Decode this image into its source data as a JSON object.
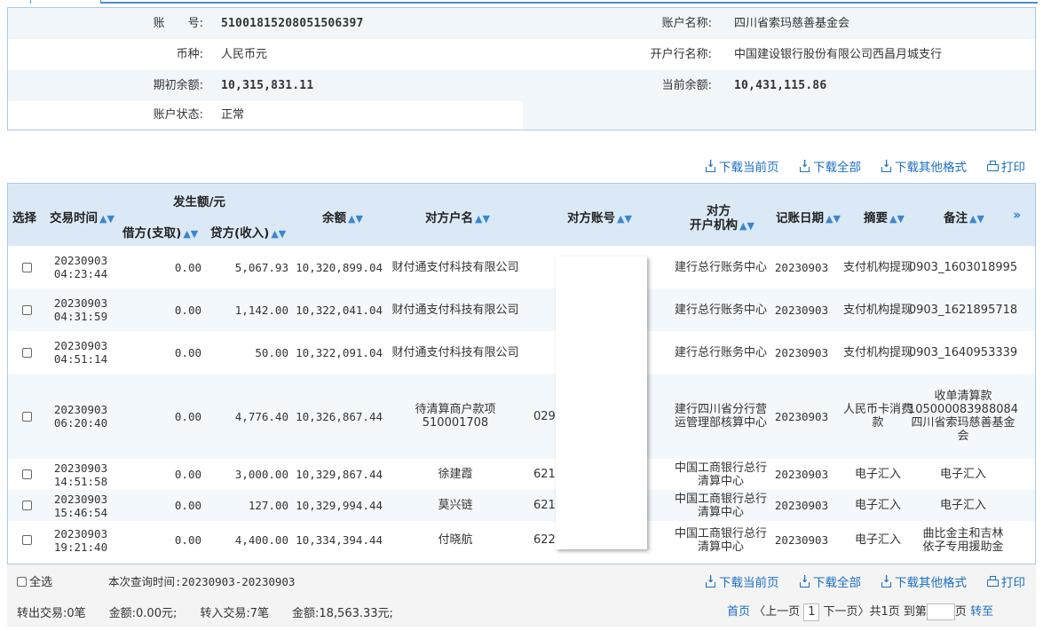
{
  "account": {
    "acct_no_label": "账　　号:",
    "acct_no": "51001815208051506397",
    "acct_name_label": "账户名称:",
    "acct_name": "四川省索玛慈善基金会",
    "currency_label": "币种:",
    "currency": "人民币元",
    "bank_label": "开户行名称:",
    "bank": "中国建设银行股份有限公司西昌月城支行",
    "opening_balance_label": "期初余额:",
    "opening_balance": "10,315,831.11",
    "current_balance_label": "当前余额:",
    "current_balance": "10,431,115.86",
    "status_label": "账户状态:",
    "status": "正常"
  },
  "actions": {
    "download_page": "下载当前页",
    "download_all": "下载全部",
    "download_other": "下载其他格式",
    "print": "打印"
  },
  "table": {
    "headers": {
      "select": "选择",
      "time": "交易时间",
      "amount_group": "发生额/元",
      "debit": "借方(支取)",
      "credit": "贷方(收入)",
      "balance": "余额",
      "counterparty_name": "对方户名",
      "counterparty_acct": "对方账号",
      "counterparty_bank_1": "对方",
      "counterparty_bank_2": "开户机构",
      "post_date": "记账日期",
      "summary": "摘要",
      "remark": "备注",
      "expand": "»"
    },
    "rows": [
      {
        "time1": "20230903",
        "time2": "04:23:44",
        "debit": "0.00",
        "credit": "5,067.93",
        "balance": "10,320,899.04",
        "name": "财付通支付科技有限公司",
        "acct": "",
        "bank": "建行总行账务中心",
        "date": "20230903",
        "summary": "支付机构提现",
        "remark": "0903_1603018995"
      },
      {
        "time1": "20230903",
        "time2": "04:31:59",
        "debit": "0.00",
        "credit": "1,142.00",
        "balance": "10,322,041.04",
        "name": "财付通支付科技有限公司",
        "acct": "",
        "bank": "建行总行账务中心",
        "date": "20230903",
        "summary": "支付机构提现",
        "remark": "0903_1621895718"
      },
      {
        "time1": "20230903",
        "time2": "04:51:14",
        "debit": "0.00",
        "credit": "50.00",
        "balance": "10,322,091.04",
        "name": "财付通支付科技有限公司",
        "acct": "",
        "bank": "建行总行账务中心",
        "date": "20230903",
        "summary": "支付机构提现",
        "remark": "0903_1640953339"
      },
      {
        "time1": "20230903",
        "time2": "06:20:40",
        "debit": "0.00",
        "credit": "4,776.40",
        "balance": "10,326,867.44",
        "name": "待清算商户款项510001708",
        "acct": "029100",
        "bank": "建行四川省分行营运管理部核算中心",
        "date": "20230903",
        "summary": "人民币卡消费款",
        "remark": "收单清算款105000083988084四川省索玛慈善基金会"
      },
      {
        "time1": "20230903",
        "time2": "14:51:58",
        "debit": "0.00",
        "credit": "3,000.00",
        "balance": "10,329,867.44",
        "name": "徐建霞",
        "acct": "62125",
        "bank": "中国工商银行总行清算中心",
        "date": "20230903",
        "summary": "电子汇入",
        "remark": "电子汇入"
      },
      {
        "time1": "20230903",
        "time2": "15:46:54",
        "debit": "0.00",
        "credit": "127.00",
        "balance": "10,329,994.44",
        "name": "莫兴链",
        "acct": "62129",
        "bank": "中国工商银行总行清算中心",
        "date": "20230903",
        "summary": "电子汇入",
        "remark": "电子汇入"
      },
      {
        "time1": "20230903",
        "time2": "19:21:40",
        "debit": "0.00",
        "credit": "4,400.00",
        "balance": "10,334,394.44",
        "name": "付晓航",
        "acct": "62222",
        "bank": "中国工商银行总行清算中心",
        "date": "20230903",
        "summary": "电子汇入",
        "remark": "曲比金主和吉林依子专用援助金"
      }
    ]
  },
  "footer": {
    "select_all": "全选",
    "query_time": "本次查询时间:20230903-20230903",
    "summary": "转出交易:0笔　　金额:0.00元;　　转入交易:7笔　　金额:18,563.33元;",
    "pager_first": "首页",
    "pager_prev": "〈上一页",
    "pager_current": "1",
    "pager_next": "下一页〉",
    "pager_total": "共1页",
    "pager_goto": "到第",
    "pager_page_unit": "页",
    "pager_go": "转至"
  }
}
